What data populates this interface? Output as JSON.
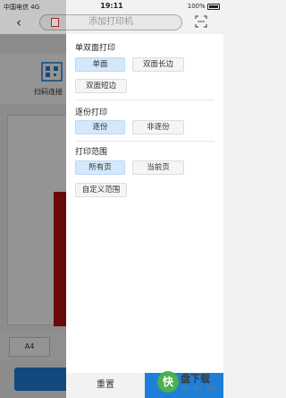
{
  "status_bar": {
    "carrier": "中国电信",
    "network": "4G",
    "time": "19:11",
    "battery": "100%"
  },
  "nav": {
    "back_icon": "chevron-left-icon",
    "title": "添加打印机",
    "scan_icon": "scan-icon"
  },
  "background": {
    "scan_label": "扫码连接",
    "paper_size": "A4",
    "accent": "#1e7fd8"
  },
  "panel": {
    "duplex": {
      "title": "单双面打印",
      "options": [
        "单面",
        "双面长边",
        "双面短边"
      ],
      "selected": "单面"
    },
    "collate": {
      "title": "逐份打印",
      "options": [
        "逐份",
        "非逐份"
      ],
      "selected": "逐份"
    },
    "range": {
      "title": "打印范围",
      "options": [
        "所有页",
        "当前页",
        "自定义范围"
      ],
      "selected": "所有页"
    },
    "reset_label": "重置"
  },
  "colors": {
    "selected_bg": "#d4e8fb",
    "primary": "#1e7fd8"
  },
  "watermark": {
    "main": "盘下载",
    "sub": "绿色 · 安全 · 免费"
  }
}
